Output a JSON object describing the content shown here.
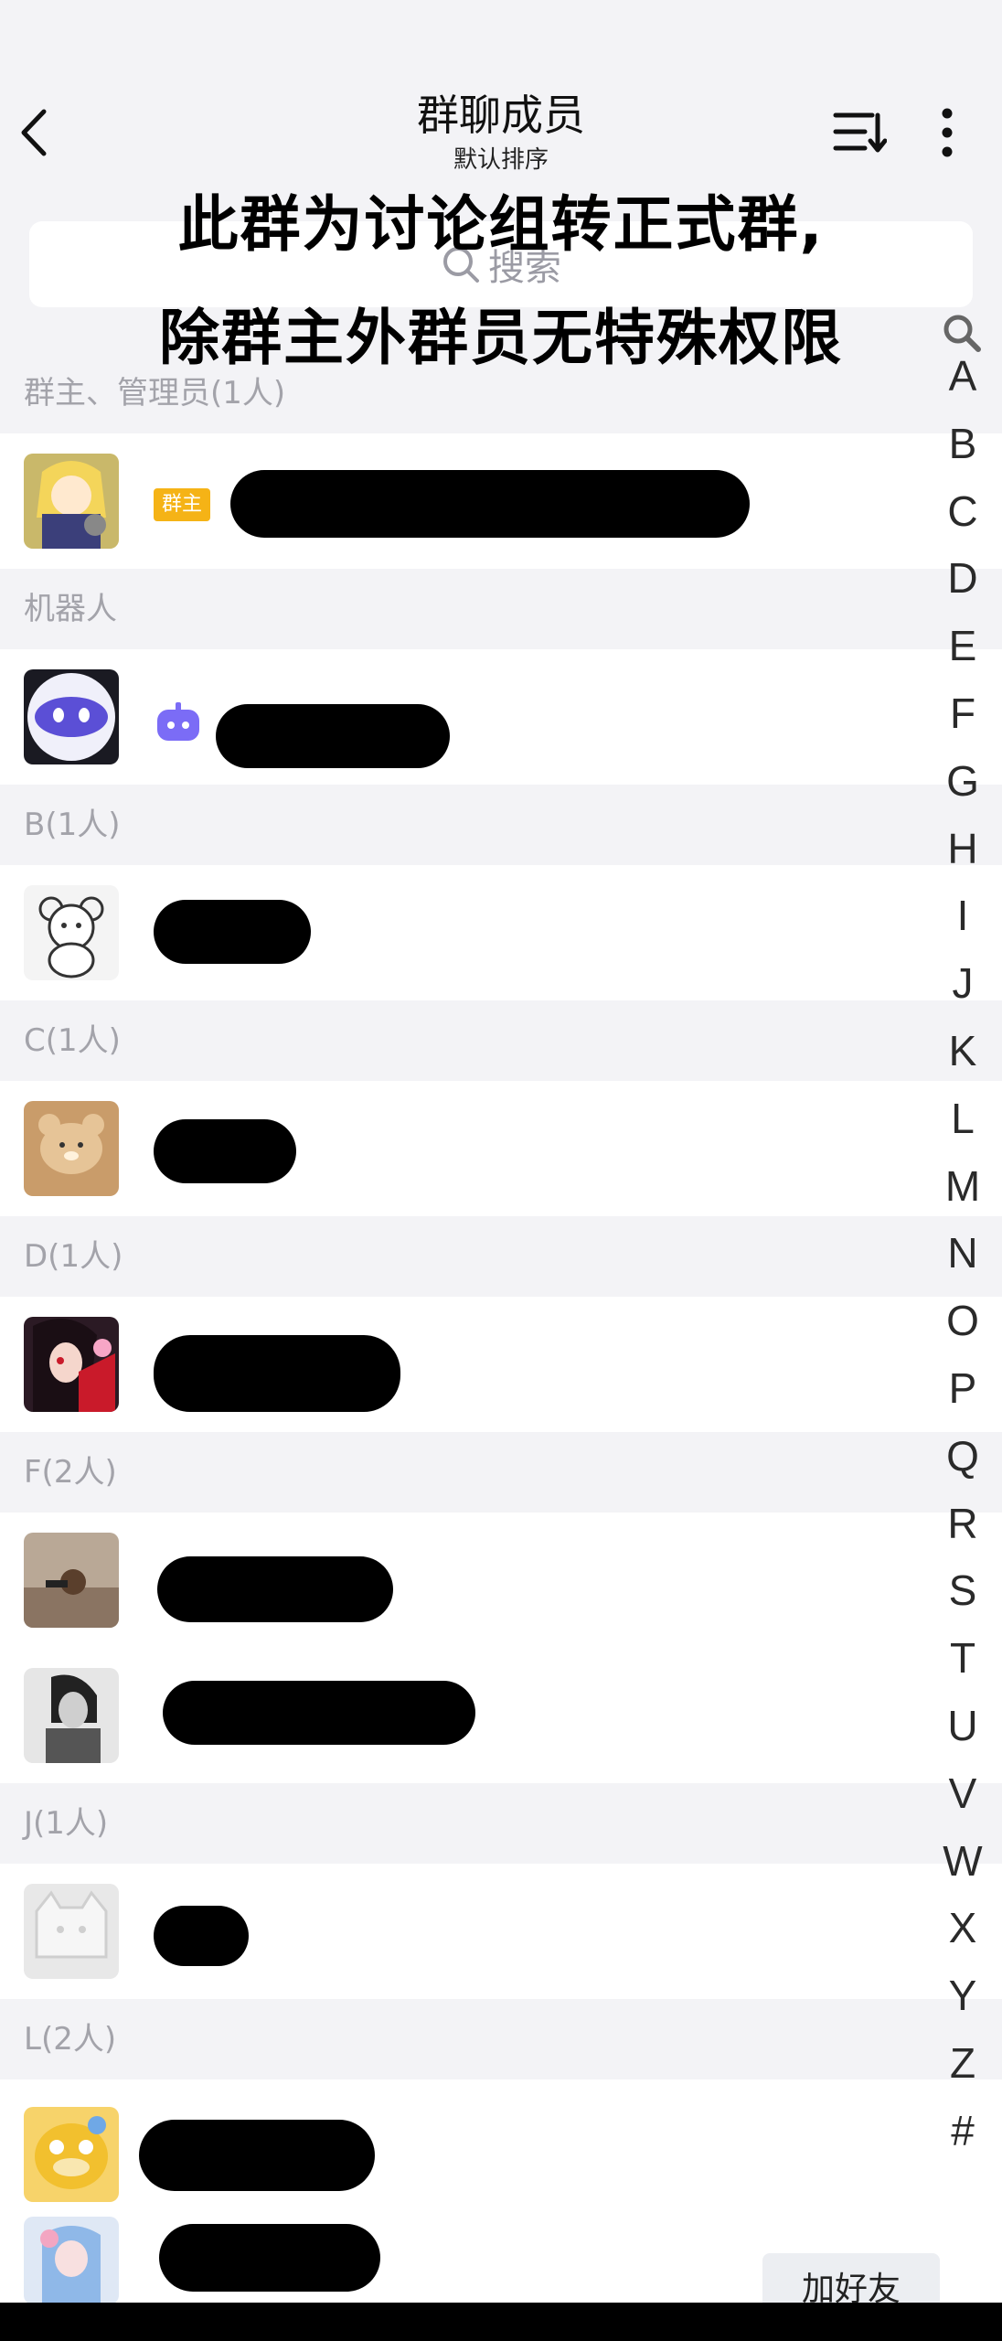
{
  "header": {
    "title": "群聊成员",
    "subtitle": "默认排序"
  },
  "search": {
    "placeholder": "搜索"
  },
  "notice": {
    "line1": "此群为讨论组转正式群,",
    "line2": "除群主外群员无特殊权限"
  },
  "sections": {
    "owners": "群主、管理员(1人)",
    "robots": "机器人",
    "b": "B(1人)",
    "c": "C(1人)",
    "d": "D(1人)",
    "f": "F(2人)",
    "j": "J(1人)",
    "l": "L(2人)"
  },
  "badges": {
    "owner": "群主"
  },
  "index_letters": [
    "A",
    "B",
    "C",
    "D",
    "E",
    "F",
    "G",
    "H",
    "I",
    "J",
    "K",
    "L",
    "M",
    "N",
    "O",
    "P",
    "Q",
    "R",
    "S",
    "T",
    "U",
    "V",
    "W",
    "X",
    "Y",
    "Z",
    "#"
  ],
  "actions": {
    "add_friend": "加好友"
  },
  "colors": {
    "background": "#f3f3f6",
    "owner_badge": "#f5b316",
    "robot_icon": "#7b6cf6",
    "section_text": "#a3a3aa"
  }
}
